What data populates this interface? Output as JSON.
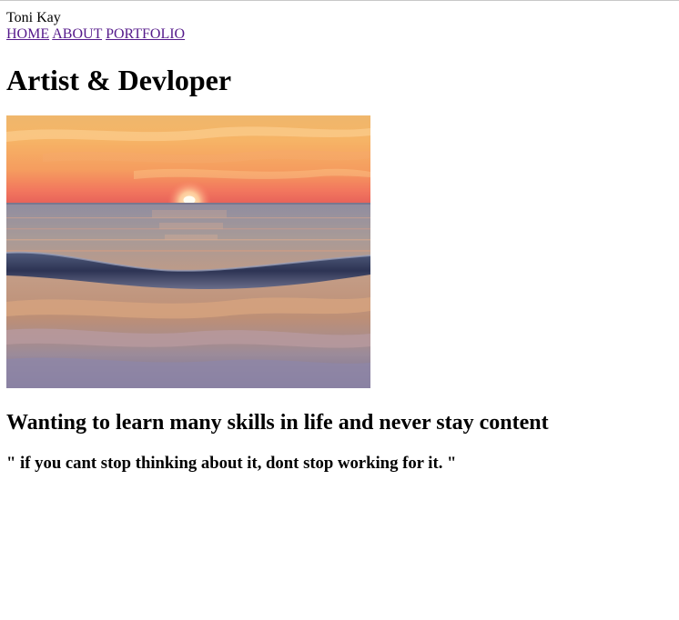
{
  "header": {
    "site_name": "Toni Kay",
    "nav": [
      "HOME",
      "ABOUT",
      "PORTFOLIO"
    ]
  },
  "main": {
    "title": "Artist & Devloper",
    "hero_image_subject": "sunset-over-ocean-wave",
    "tagline": "Wanting to learn many skills in life and never stay content",
    "quote": "\" if you cant stop thinking about it, dont stop working for it. \""
  },
  "colors": {
    "link": "#551a8b",
    "text": "#000000",
    "background": "#ffffff"
  }
}
